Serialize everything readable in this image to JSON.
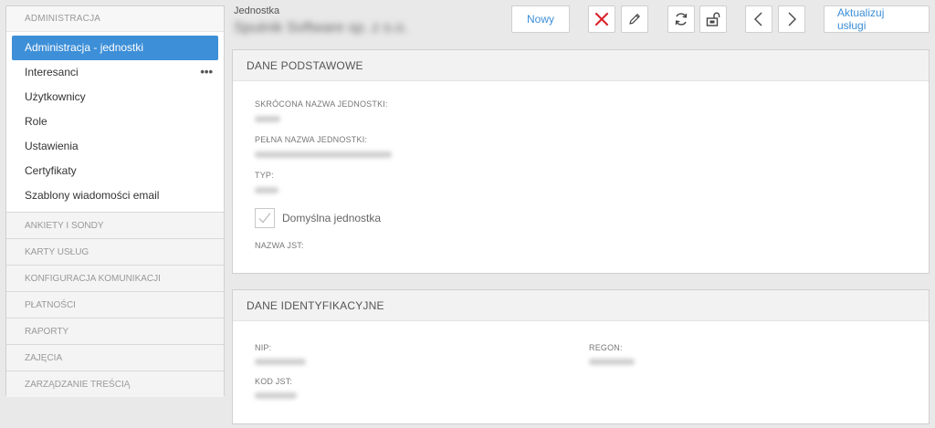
{
  "sidebar": {
    "header": "ADMINISTRACJA",
    "items": [
      {
        "label": "Administracja - jednostki",
        "active": true
      },
      {
        "label": "Interesanci",
        "has_menu": true
      },
      {
        "label": "Użytkownicy"
      },
      {
        "label": "Role"
      },
      {
        "label": "Ustawienia"
      },
      {
        "label": "Certyfikaty"
      },
      {
        "label": "Szablony wiadomości email"
      }
    ],
    "sections": [
      "ANKIETY I SONDY",
      "KARTY USŁUG",
      "KONFIGURACJA KOMUNIKACJI",
      "PŁATNOŚCI",
      "RAPORTY",
      "ZAJĘCIA",
      "ZARZĄDZANIE TREŚCIĄ"
    ],
    "more_icon": "•••"
  },
  "header": {
    "label": "Jednostka",
    "entity_name": "Sputnik Software sp. z o.o."
  },
  "toolbar": {
    "new_label": "Nowy",
    "update_label": "Aktualizuj usługi",
    "icons": [
      "delete-icon",
      "edit-icon",
      "refresh-icon",
      "unlock-icon",
      "prev-icon",
      "next-icon"
    ],
    "delete_color": "#d9262e",
    "accent_color": "#3d8fd8"
  },
  "panel_basic": {
    "title": "DANE PODSTAWOWE",
    "short_name_label": "SKRÓCONA NAZWA JEDNOSTKI:",
    "full_name_label": "PEŁNA NAZWA JEDNOSTKI:",
    "type_label": "TYP:",
    "default_label": "Domyślna jednostka",
    "default_checked": true,
    "jst_name_label": "NAZWA JST:"
  },
  "panel_ident": {
    "title": "DANE IDENTYFIKACYJNE",
    "nip_label": "NIP:",
    "regon_label": "REGON:",
    "kod_jst_label": "KOD JST:"
  }
}
